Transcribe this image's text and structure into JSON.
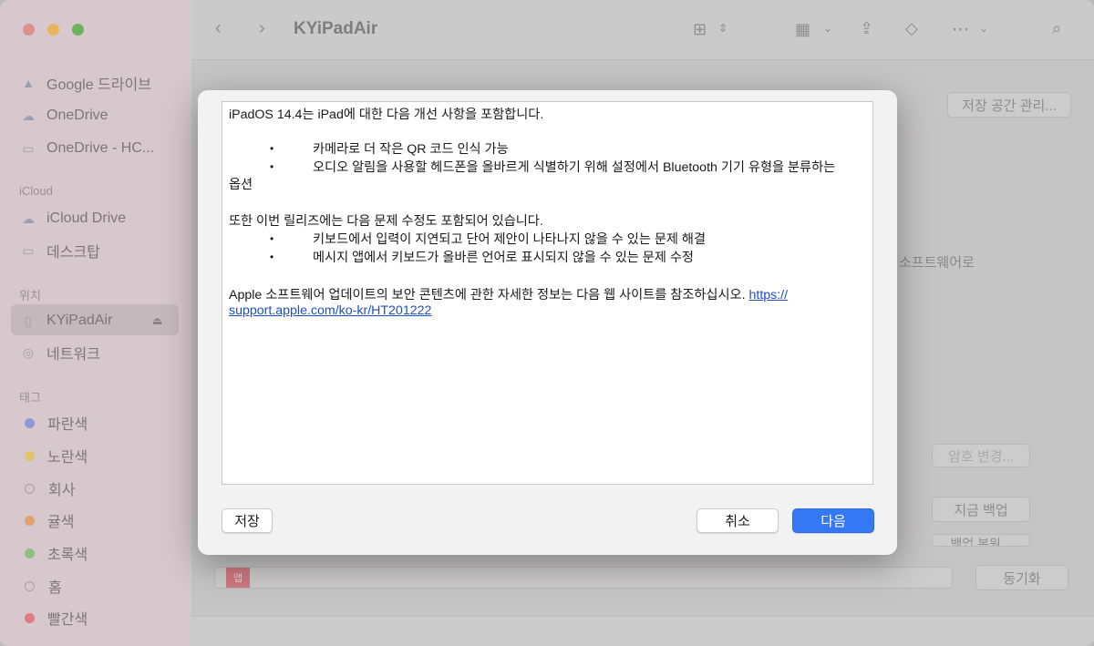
{
  "window": {
    "title": "KYiPadAir"
  },
  "sidebar": {
    "favorites": [
      {
        "label": "Google 드라이브",
        "icon": "cloud-drive-icon"
      },
      {
        "label": "OneDrive",
        "icon": "cloud-icon"
      },
      {
        "label": "OneDrive - HC...",
        "icon": "folder-icon"
      }
    ],
    "icloud_header": "iCloud",
    "icloud": [
      {
        "label": "iCloud Drive",
        "icon": "cloud-icon"
      },
      {
        "label": "데스크탑",
        "icon": "desktop-icon"
      }
    ],
    "locations_header": "위치",
    "locations": [
      {
        "label": "KYiPadAir",
        "icon": "ipad-icon",
        "selected": true
      },
      {
        "label": "네트워크",
        "icon": "globe-icon"
      }
    ],
    "tags_header": "태그",
    "tags": [
      {
        "label": "파란색",
        "color": "#8e98d6"
      },
      {
        "label": "노란색",
        "color": "#e2c36b"
      },
      {
        "label": "회사",
        "color": ""
      },
      {
        "label": "귤색",
        "color": "#e4a26c"
      },
      {
        "label": "초록색",
        "color": "#8ec07f"
      },
      {
        "label": "홈",
        "color": ""
      },
      {
        "label": "빨간색",
        "color": "#e07a83"
      }
    ]
  },
  "background": {
    "manage_storage": "저장 공간 관리...",
    "software_text": "소프트웨어로",
    "change_password": "암호 변경...",
    "backup_now": "지금 백업",
    "restore_backup": "백업 복원...",
    "sync": "동기화",
    "storage_bar_label": "앱"
  },
  "dialog": {
    "lines": [
      "iPadOS 14.4는 iPad에 대한 다음 개선 사항을 포함합니다.",
      "카메라로 더 작은 QR 코드 인식 가능",
      "오디오 알림을 사용할 헤드폰을 올바르게 식별하기 위해 설정에서 Bluetooth 기기 유형을 분류하는",
      "옵션",
      "또한 이번 릴리즈에는 다음 문제 수정도 포함되어 있습니다.",
      "키보드에서 입력이 지연되고 단어 제안이 나타나지 않을 수 있는 문제 해결",
      "메시지 앱에서 키보드가 올바른 언어로 표시되지 않을 수 있는 문제 수정",
      "Apple 소프트웨어 업데이트의 보안 콘텐츠에 관한 자세한 정보는 다음 웹 사이트를 참조하십시오. "
    ],
    "bullet": "•",
    "link_part1": "https://",
    "link_part2": "support.apple.com/ko-kr/HT201222",
    "save_label": "저장",
    "cancel_label": "취소",
    "next_label": "다음"
  },
  "colors": {
    "accent": "#3478f6",
    "link": "#1b50c6"
  }
}
